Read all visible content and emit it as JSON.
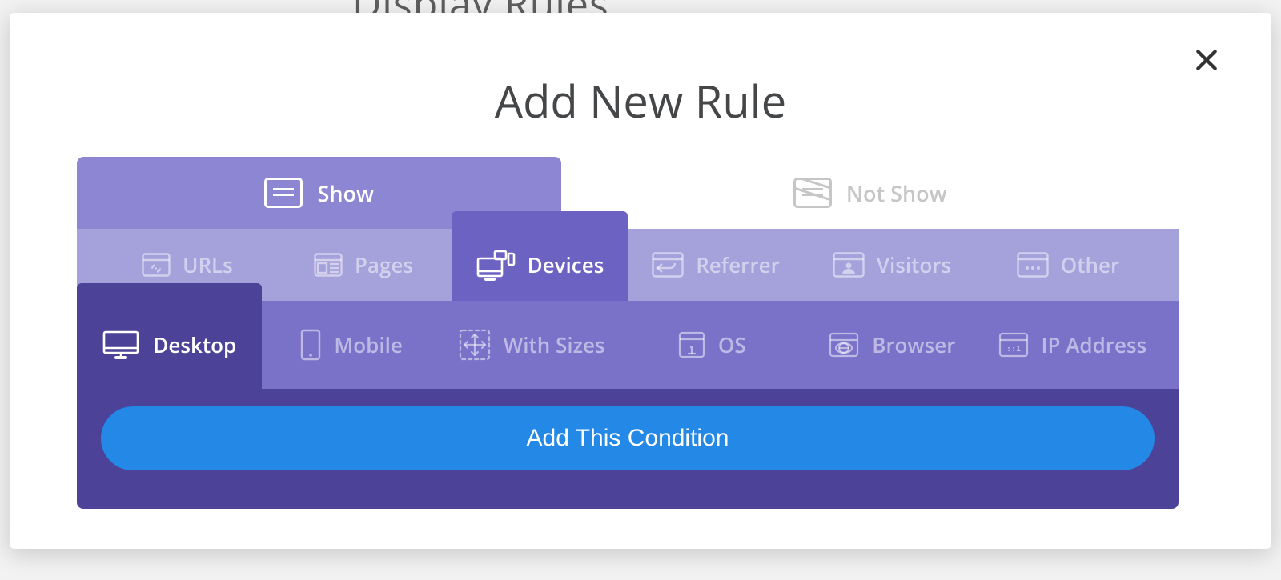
{
  "backdrop_title": "Display Rules",
  "modal": {
    "title": "Add New Rule",
    "mode_tabs": {
      "show": "Show",
      "not_show": "Not Show"
    },
    "category_tabs": {
      "urls": "URLs",
      "pages": "Pages",
      "devices": "Devices",
      "referrer": "Referrer",
      "visitors": "Visitors",
      "other": "Other"
    },
    "sub_tabs": {
      "desktop": "Desktop",
      "mobile": "Mobile",
      "with_sizes": "With Sizes",
      "os": "OS",
      "browser": "Browser",
      "ip_address": "IP Address"
    },
    "action_button": "Add This Condition",
    "active": {
      "mode": "show",
      "category": "devices",
      "sub": "desktop"
    }
  }
}
